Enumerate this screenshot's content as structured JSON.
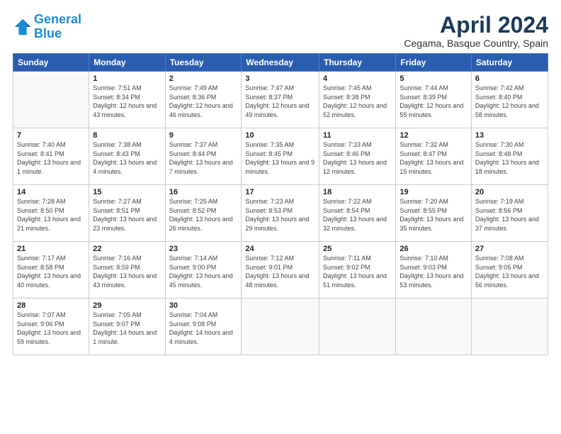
{
  "header": {
    "logo_line1": "General",
    "logo_line2": "Blue",
    "month_title": "April 2024",
    "location": "Cegama, Basque Country, Spain"
  },
  "weekdays": [
    "Sunday",
    "Monday",
    "Tuesday",
    "Wednesday",
    "Thursday",
    "Friday",
    "Saturday"
  ],
  "weeks": [
    [
      {
        "day": "",
        "info": ""
      },
      {
        "day": "1",
        "info": "Sunrise: 7:51 AM\nSunset: 8:34 PM\nDaylight: 12 hours\nand 43 minutes."
      },
      {
        "day": "2",
        "info": "Sunrise: 7:49 AM\nSunset: 8:36 PM\nDaylight: 12 hours\nand 46 minutes."
      },
      {
        "day": "3",
        "info": "Sunrise: 7:47 AM\nSunset: 8:37 PM\nDaylight: 12 hours\nand 49 minutes."
      },
      {
        "day": "4",
        "info": "Sunrise: 7:45 AM\nSunset: 8:38 PM\nDaylight: 12 hours\nand 52 minutes."
      },
      {
        "day": "5",
        "info": "Sunrise: 7:44 AM\nSunset: 8:39 PM\nDaylight: 12 hours\nand 55 minutes."
      },
      {
        "day": "6",
        "info": "Sunrise: 7:42 AM\nSunset: 8:40 PM\nDaylight: 12 hours\nand 58 minutes."
      }
    ],
    [
      {
        "day": "7",
        "info": "Sunrise: 7:40 AM\nSunset: 8:41 PM\nDaylight: 13 hours\nand 1 minute."
      },
      {
        "day": "8",
        "info": "Sunrise: 7:38 AM\nSunset: 8:43 PM\nDaylight: 13 hours\nand 4 minutes."
      },
      {
        "day": "9",
        "info": "Sunrise: 7:37 AM\nSunset: 8:44 PM\nDaylight: 13 hours\nand 7 minutes."
      },
      {
        "day": "10",
        "info": "Sunrise: 7:35 AM\nSunset: 8:45 PM\nDaylight: 13 hours\nand 9 minutes."
      },
      {
        "day": "11",
        "info": "Sunrise: 7:33 AM\nSunset: 8:46 PM\nDaylight: 13 hours\nand 12 minutes."
      },
      {
        "day": "12",
        "info": "Sunrise: 7:32 AM\nSunset: 8:47 PM\nDaylight: 13 hours\nand 15 minutes."
      },
      {
        "day": "13",
        "info": "Sunrise: 7:30 AM\nSunset: 8:48 PM\nDaylight: 13 hours\nand 18 minutes."
      }
    ],
    [
      {
        "day": "14",
        "info": "Sunrise: 7:28 AM\nSunset: 8:50 PM\nDaylight: 13 hours\nand 21 minutes."
      },
      {
        "day": "15",
        "info": "Sunrise: 7:27 AM\nSunset: 8:51 PM\nDaylight: 13 hours\nand 23 minutes."
      },
      {
        "day": "16",
        "info": "Sunrise: 7:25 AM\nSunset: 8:52 PM\nDaylight: 13 hours\nand 26 minutes."
      },
      {
        "day": "17",
        "info": "Sunrise: 7:23 AM\nSunset: 8:53 PM\nDaylight: 13 hours\nand 29 minutes."
      },
      {
        "day": "18",
        "info": "Sunrise: 7:22 AM\nSunset: 8:54 PM\nDaylight: 13 hours\nand 32 minutes."
      },
      {
        "day": "19",
        "info": "Sunrise: 7:20 AM\nSunset: 8:55 PM\nDaylight: 13 hours\nand 35 minutes."
      },
      {
        "day": "20",
        "info": "Sunrise: 7:19 AM\nSunset: 8:56 PM\nDaylight: 13 hours\nand 37 minutes."
      }
    ],
    [
      {
        "day": "21",
        "info": "Sunrise: 7:17 AM\nSunset: 8:58 PM\nDaylight: 13 hours\nand 40 minutes."
      },
      {
        "day": "22",
        "info": "Sunrise: 7:16 AM\nSunset: 8:59 PM\nDaylight: 13 hours\nand 43 minutes."
      },
      {
        "day": "23",
        "info": "Sunrise: 7:14 AM\nSunset: 9:00 PM\nDaylight: 13 hours\nand 45 minutes."
      },
      {
        "day": "24",
        "info": "Sunrise: 7:12 AM\nSunset: 9:01 PM\nDaylight: 13 hours\nand 48 minutes."
      },
      {
        "day": "25",
        "info": "Sunrise: 7:11 AM\nSunset: 9:02 PM\nDaylight: 13 hours\nand 51 minutes."
      },
      {
        "day": "26",
        "info": "Sunrise: 7:10 AM\nSunset: 9:03 PM\nDaylight: 13 hours\nand 53 minutes."
      },
      {
        "day": "27",
        "info": "Sunrise: 7:08 AM\nSunset: 9:05 PM\nDaylight: 13 hours\nand 56 minutes."
      }
    ],
    [
      {
        "day": "28",
        "info": "Sunrise: 7:07 AM\nSunset: 9:06 PM\nDaylight: 13 hours\nand 59 minutes."
      },
      {
        "day": "29",
        "info": "Sunrise: 7:05 AM\nSunset: 9:07 PM\nDaylight: 14 hours\nand 1 minute."
      },
      {
        "day": "30",
        "info": "Sunrise: 7:04 AM\nSunset: 9:08 PM\nDaylight: 14 hours\nand 4 minutes."
      },
      {
        "day": "",
        "info": ""
      },
      {
        "day": "",
        "info": ""
      },
      {
        "day": "",
        "info": ""
      },
      {
        "day": "",
        "info": ""
      }
    ]
  ]
}
